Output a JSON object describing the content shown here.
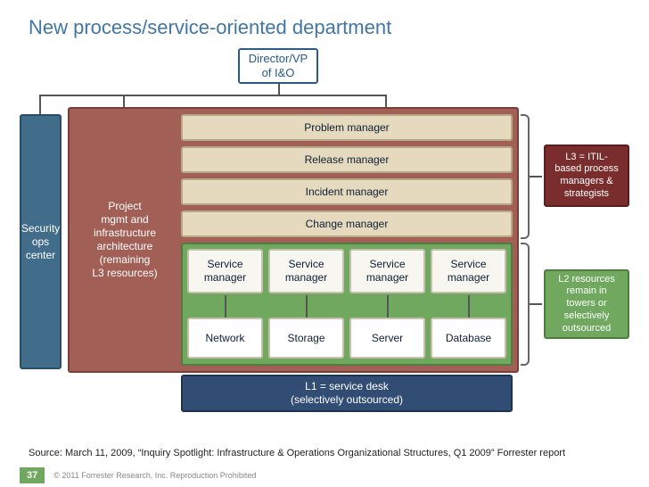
{
  "title": "New process/service-oriented department",
  "director": "Director/VP\nof I&O",
  "security": "Security\nops\ncenter",
  "project": "Project\nmgmt and\ninfrastructure\narchitecture\n(remaining\nL3 resources)",
  "process_managers": [
    "Problem manager",
    "Release manager",
    "Incident manager",
    "Change manager"
  ],
  "service_managers": [
    "Service\nmanager",
    "Service\nmanager",
    "Service\nmanager",
    "Service\nmanager"
  ],
  "service_types": [
    "Network",
    "Storage",
    "Server",
    "Database"
  ],
  "l1": "L1 = service desk\n(selectively outsourced)",
  "l3_label": "L3 = ITIL-\nbased process\nmanagers &\nstrategists",
  "l2_label": "L2 resources\nremain in\ntowers or\nselectively\noutsourced",
  "source": "Source: March 11, 2009, “Inquiry Spotlight: Infrastructure & Operations Organizational Structures, Q1 2009” Forrester report",
  "page_number": "37",
  "copyright": "© 2011 Forrester Research, Inc. Reproduction Prohibited"
}
